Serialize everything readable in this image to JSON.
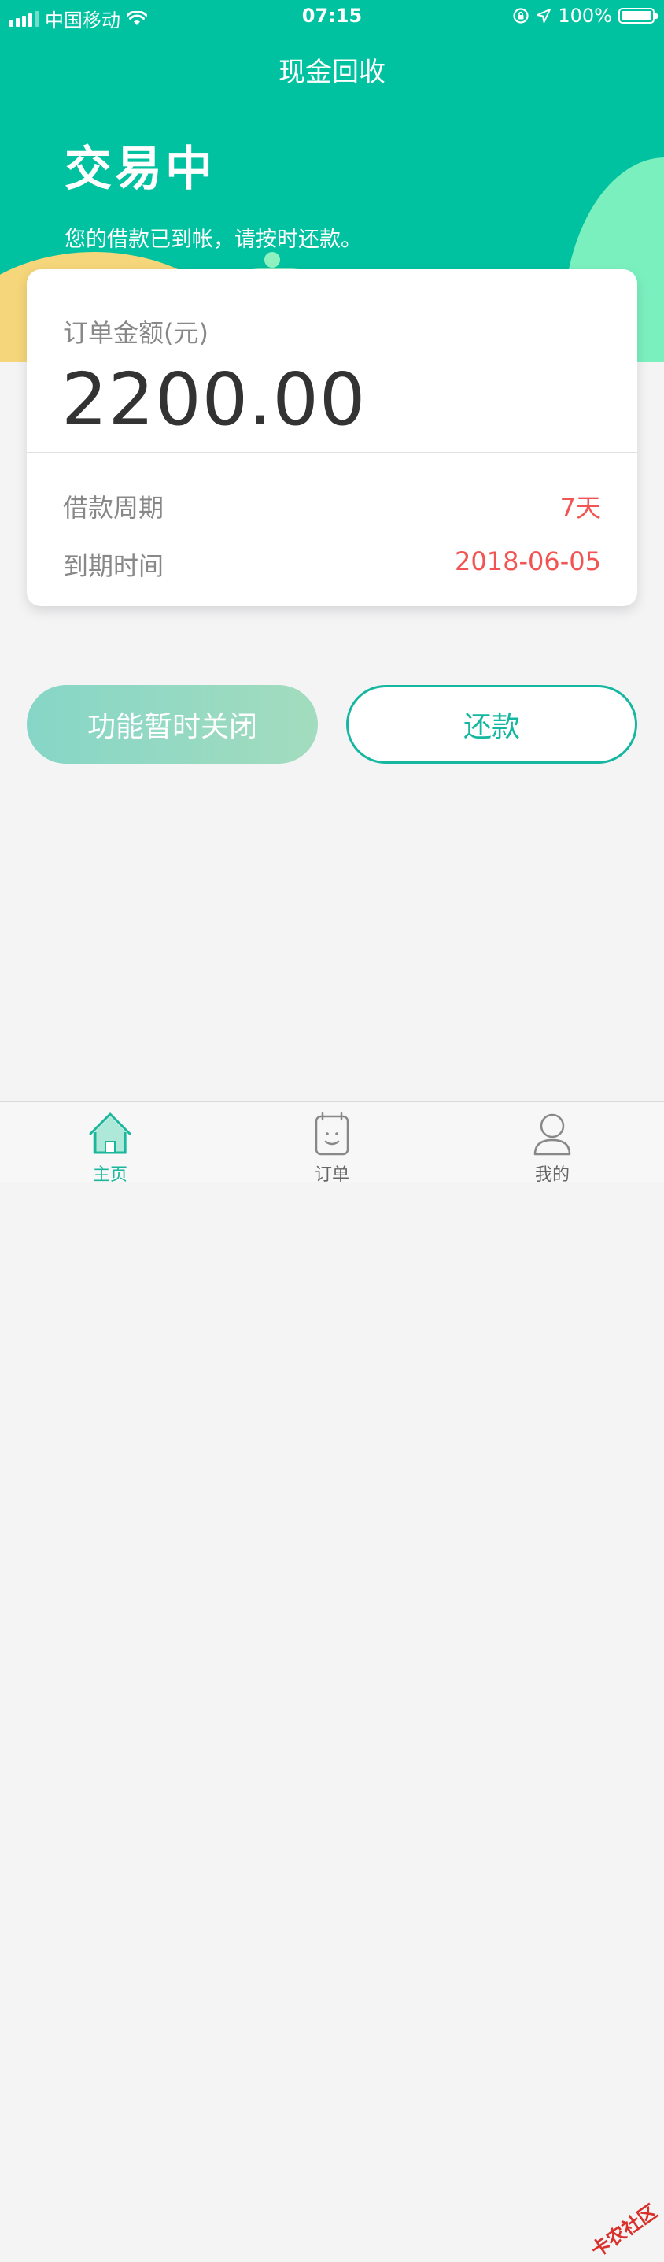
{
  "status_bar": {
    "carrier": "中国移动",
    "time": "07:15",
    "battery": "100%",
    "icons": [
      "signal-icon",
      "wifi-icon",
      "lock-rotation-icon",
      "location-icon",
      "battery-icon"
    ]
  },
  "nav": {
    "title": "现金回收"
  },
  "hero": {
    "status_title": "交易中",
    "description": "您的借款已到帐，请按时还款。"
  },
  "order_card": {
    "amount_label": "订单金额(元)",
    "amount": "2200.00",
    "rows": [
      {
        "label": "借款周期",
        "value": "7天"
      },
      {
        "label": "到期时间",
        "value": "2018-06-05"
      }
    ]
  },
  "actions": {
    "disabled_label": "功能暂时关闭",
    "repay_label": "还款"
  },
  "tabbar": {
    "items": [
      {
        "label": "主页",
        "icon": "home-icon",
        "active": true
      },
      {
        "label": "订单",
        "icon": "order-icon",
        "active": false
      },
      {
        "label": "我的",
        "icon": "user-icon",
        "active": false
      }
    ]
  },
  "watermark": {
    "text": "卡农社区"
  },
  "colors": {
    "header": "#00c2a0",
    "accent": "#15b7a1",
    "value_red": "#f25353",
    "background": "#f4f4f5"
  }
}
